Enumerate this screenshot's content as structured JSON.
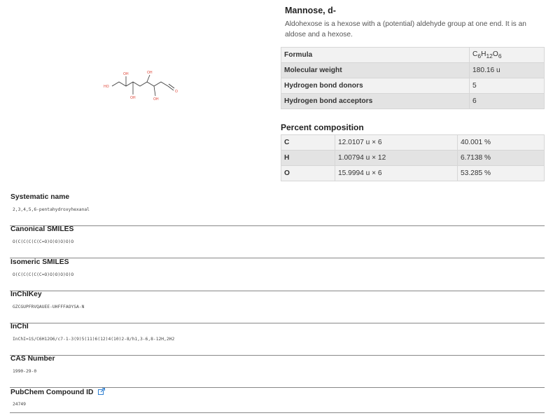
{
  "compound": {
    "name": "Mannose, d-",
    "description": "Aldohexose is a hexose with a (potential) aldehyde group at one end. It is an aldose and a hexose."
  },
  "structure": {
    "atom_labels": [
      "HO",
      "OH",
      "OH",
      "OH",
      "OH",
      "O"
    ]
  },
  "properties": [
    {
      "label": "Formula",
      "value": "C6H12O6"
    },
    {
      "label": "Molecular weight",
      "value": "180.16 u"
    },
    {
      "label": "Hydrogen bond donors",
      "value": "5"
    },
    {
      "label": "Hydrogen bond acceptors",
      "value": "6"
    }
  ],
  "formula_parts": {
    "c": "C",
    "c_sub": "6",
    "h": "H",
    "h_sub": "12",
    "o": "O",
    "o_sub": "6"
  },
  "percent_composition": {
    "title": "Percent composition",
    "rows": [
      {
        "element": "C",
        "mass": "12.0107 u × 6",
        "percent": "40.001 %"
      },
      {
        "element": "H",
        "mass": "1.00794 u × 12",
        "percent": "6.7138 %"
      },
      {
        "element": "O",
        "mass": "15.9994 u × 6",
        "percent": "53.285 %"
      }
    ]
  },
  "identifiers": [
    {
      "label": "Systematic name",
      "value": "2,3,4,5,6-pentahydroxyhexanal"
    },
    {
      "label": "Canonical SMILES",
      "value": "O(C(C(C(C(C=O)O)O)O)O)O"
    },
    {
      "label": "Isomeric SMILES",
      "value": "O(C(C(C(C(C=O)O)O)O)O)O"
    },
    {
      "label": "InChIKey",
      "value": "GZCGUPFRVQAUEE-UHFFFAOYSA-N"
    },
    {
      "label": "InChI",
      "value": "InChI=1S/C6H12O6/c7-1-3(9)5(11)6(12)4(10)2-8/h1,3-6,8-12H,2H2"
    },
    {
      "label": "CAS Number",
      "value": "1990-29-0"
    },
    {
      "label": "PubChem Compound ID",
      "value": "24749"
    }
  ]
}
